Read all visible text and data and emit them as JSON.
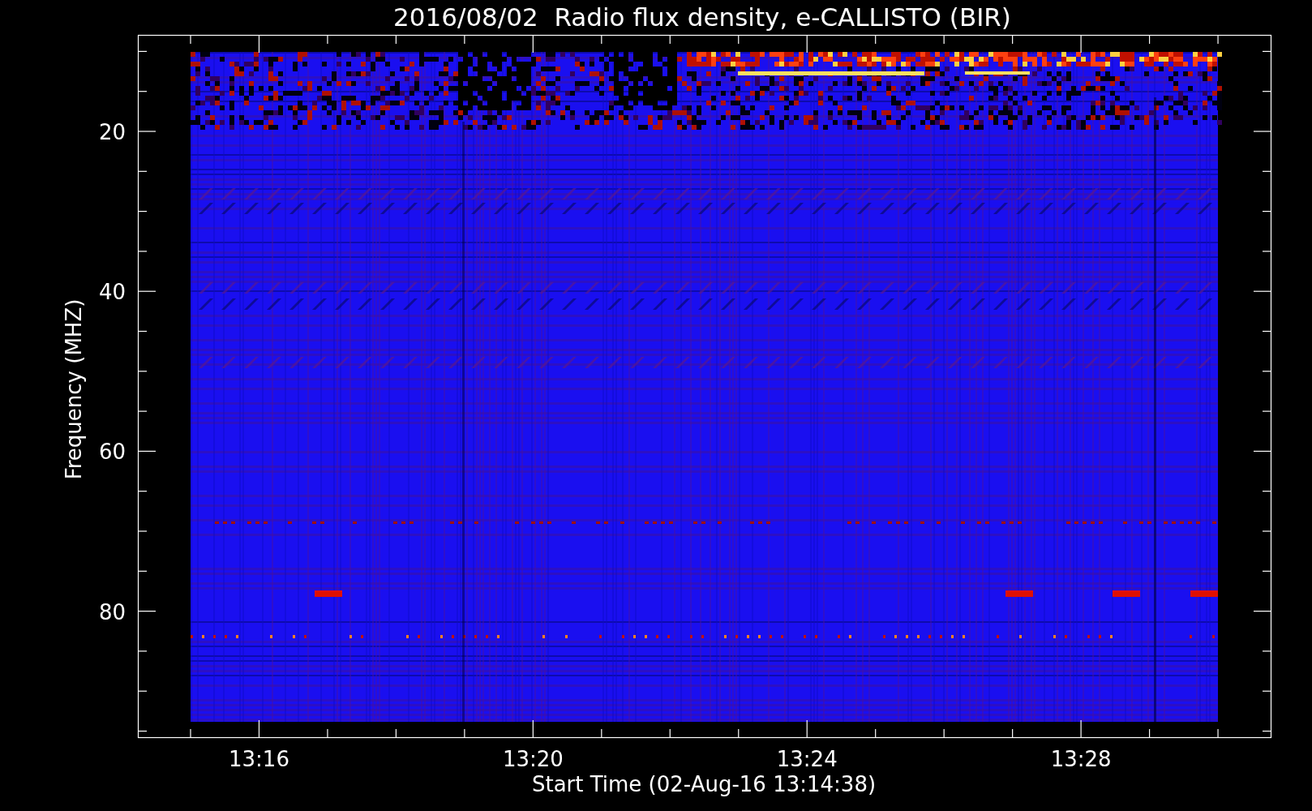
{
  "title": "2016/08/02  Radio flux density, e-CALLISTO (BIR)",
  "ylabel": "Frequency (MHZ)",
  "xlabel": "Start Time (02-Aug-16 13:14:38)",
  "yticks": [
    "20",
    "40",
    "60",
    "80"
  ],
  "xticks": [
    "13:16",
    "13:20",
    "13:24",
    "13:28"
  ]
}
